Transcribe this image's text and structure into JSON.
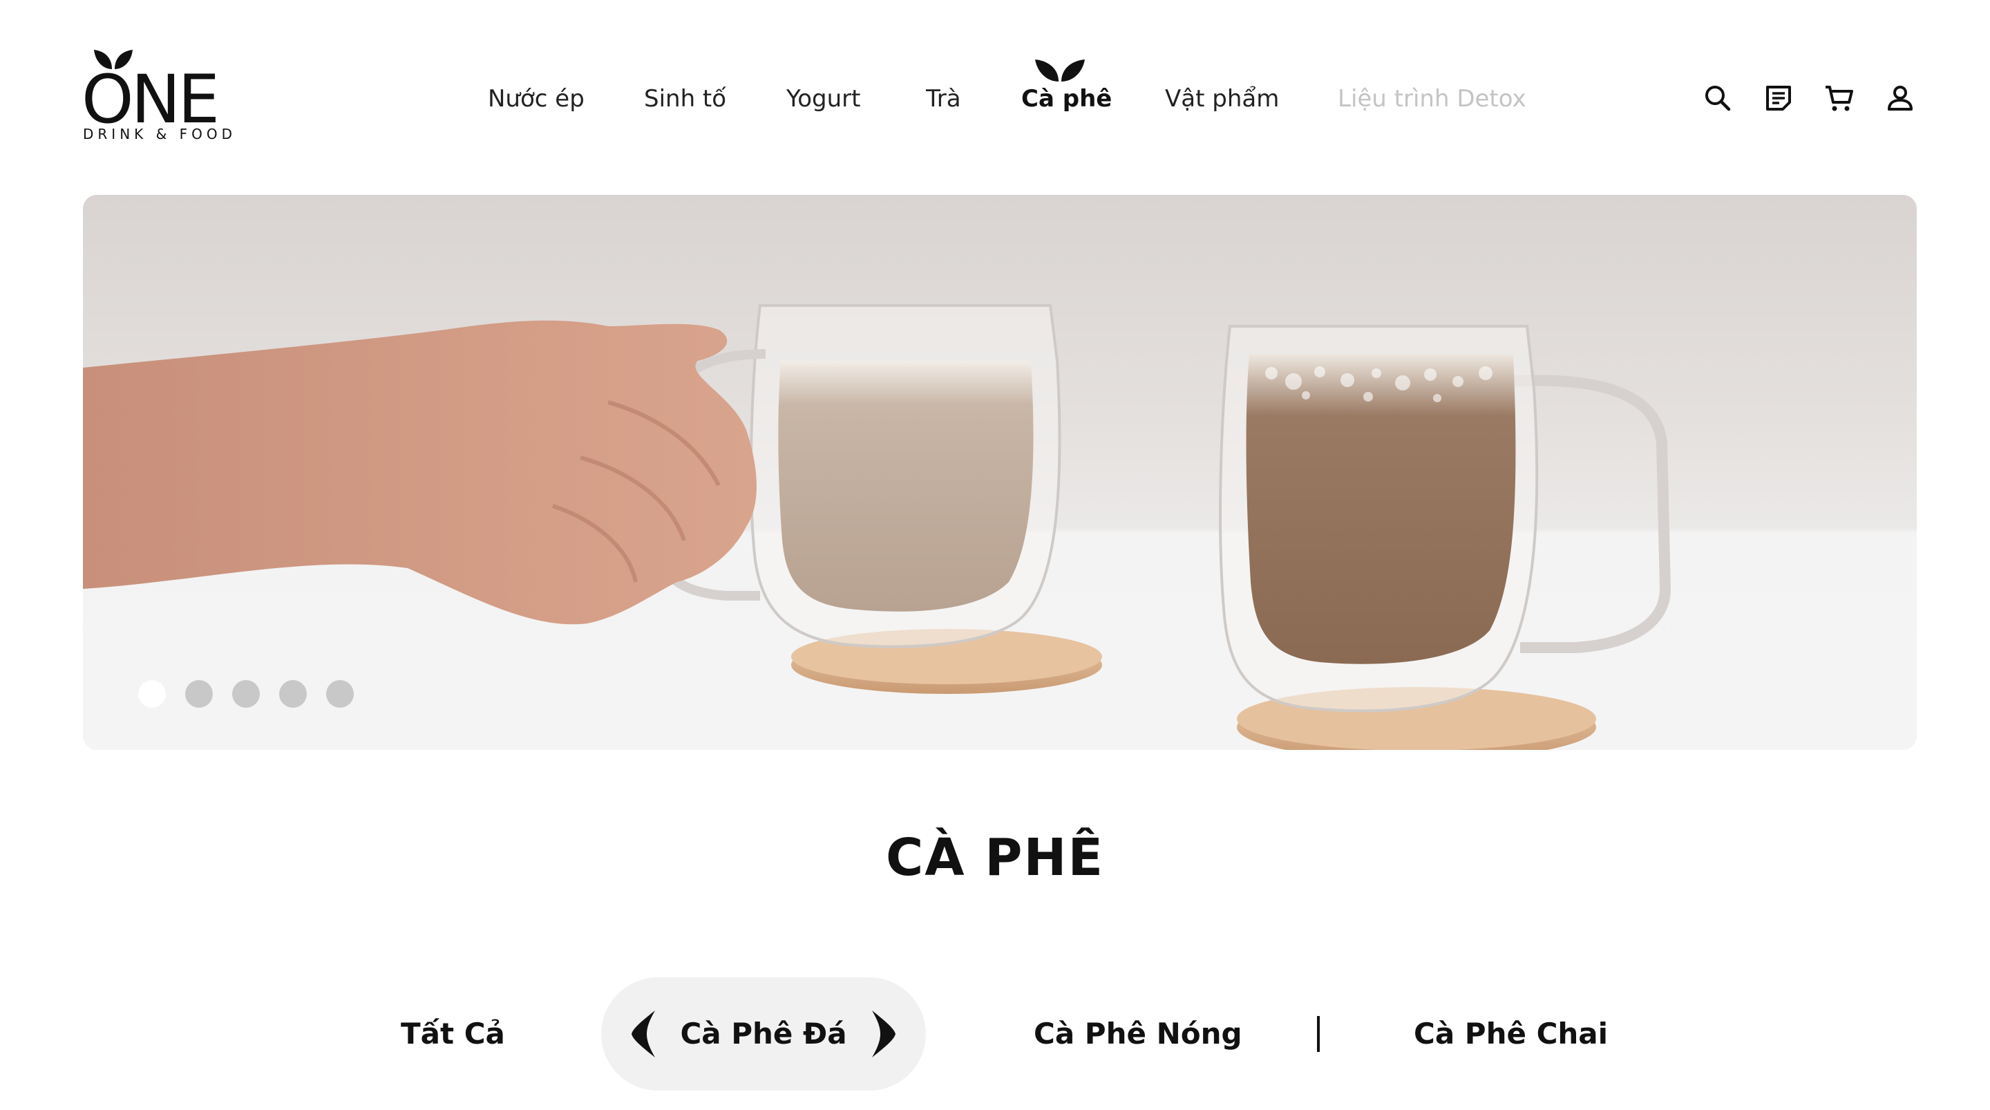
{
  "brand": {
    "logo_word": "ONE",
    "logo_sub": "DRINK & FOOD"
  },
  "nav": {
    "items": [
      {
        "label": "Nước ép",
        "state": "normal"
      },
      {
        "label": "Sinh tố",
        "state": "normal"
      },
      {
        "label": "Yogurt",
        "state": "normal"
      },
      {
        "label": "Trà",
        "state": "normal"
      },
      {
        "label": "Cà phê",
        "state": "active"
      },
      {
        "label": "Vật phẩm",
        "state": "normal"
      },
      {
        "label": "Liệu trình Detox",
        "state": "muted"
      }
    ]
  },
  "header_icons": [
    "search-icon",
    "notes-icon",
    "cart-icon",
    "user-icon"
  ],
  "hero": {
    "slide_count": 5,
    "active_slide": 1
  },
  "section": {
    "title": "CÀ PHÊ"
  },
  "tabs": {
    "items": [
      {
        "label": "Tất Cả"
      },
      {
        "label": "Cà Phê Đá"
      },
      {
        "label": "Cà Phê Nóng"
      },
      {
        "label": "Cà Phê Chai"
      }
    ],
    "active_index": 1
  },
  "colors": {
    "text": "#111111",
    "muted": "#c4c4c4",
    "tab_active_bg": "#f1f1f1",
    "dot_inactive": "#c8c8c8",
    "dot_active": "#ffffff"
  }
}
